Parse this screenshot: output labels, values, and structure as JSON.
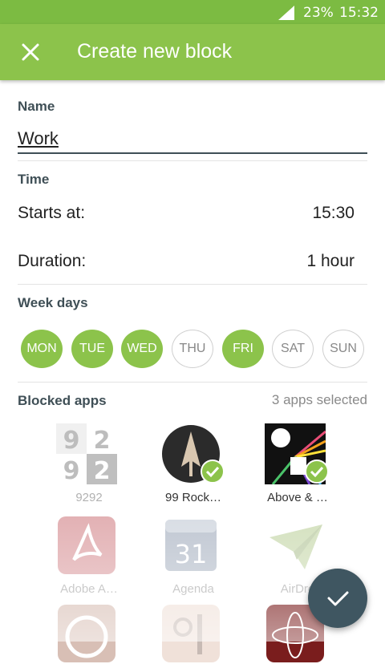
{
  "status_bar": {
    "battery": "23%",
    "time": "15:32",
    "icons": [
      "signal-icon"
    ]
  },
  "app_bar": {
    "title": "Create new block",
    "close_icon": "close-icon"
  },
  "name_section": {
    "label": "Name",
    "value": "Work"
  },
  "time_section": {
    "label": "Time",
    "starts_at": {
      "label": "Starts at:",
      "value": "15:30"
    },
    "duration": {
      "label": "Duration:",
      "value": "1 hour"
    }
  },
  "week_days": {
    "label": "Week days",
    "days": [
      {
        "label": "MON",
        "selected": true
      },
      {
        "label": "TUE",
        "selected": true
      },
      {
        "label": "WED",
        "selected": true
      },
      {
        "label": "THU",
        "selected": false
      },
      {
        "label": "FRI",
        "selected": true
      },
      {
        "label": "SAT",
        "selected": false
      },
      {
        "label": "SUN",
        "selected": false
      }
    ]
  },
  "blocked_apps": {
    "label": "Blocked apps",
    "count": "3 apps selected",
    "apps": [
      {
        "name": "9292",
        "selected": false
      },
      {
        "name": "99 Rock…",
        "selected": true
      },
      {
        "name": "Above & …",
        "selected": true
      },
      {
        "name": "Adobe A…",
        "selected": false
      },
      {
        "name": "Agenda",
        "selected": false
      },
      {
        "name": "AirDro",
        "selected": false
      },
      {
        "name": "",
        "selected": false
      },
      {
        "name": "",
        "selected": false
      },
      {
        "name": "",
        "selected": true
      }
    ],
    "icon_texts": {
      "n1": "9",
      "n2": "2",
      "n3": "9",
      "n4": "2",
      "agenda_day": "31"
    }
  },
  "fab": {
    "icon": "check-icon"
  },
  "colors": {
    "accent": "#8cc34b",
    "status_bar": "#7cbb42",
    "fab": "#3f5661",
    "heading": "#3f4f56"
  }
}
